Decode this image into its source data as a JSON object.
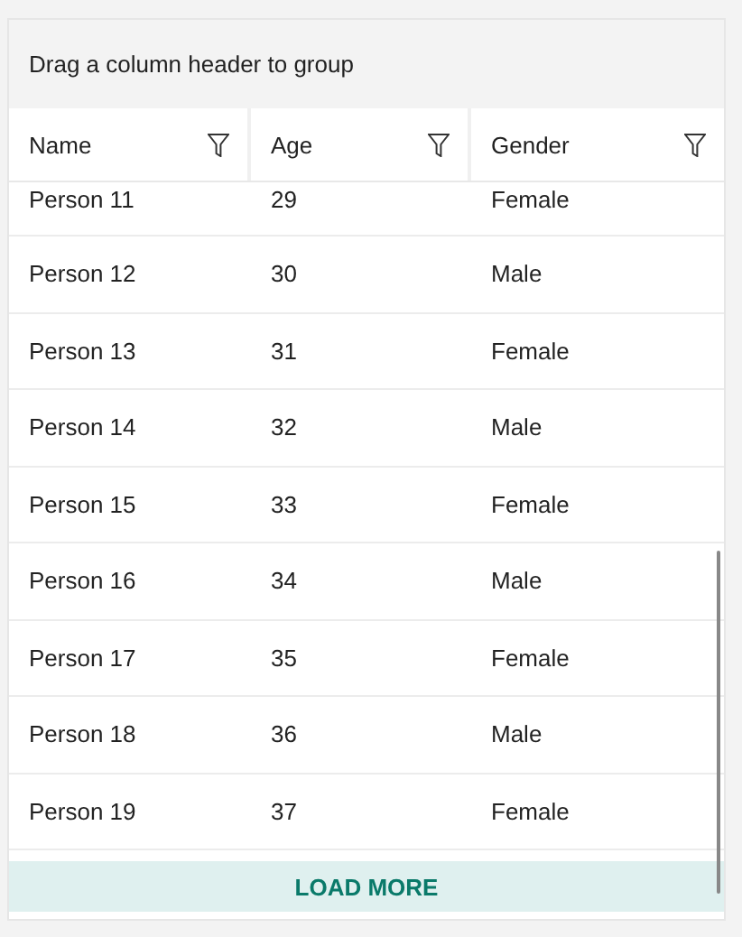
{
  "group_panel": {
    "text": "Drag a column header to group"
  },
  "columns": [
    {
      "label": "Name"
    },
    {
      "label": "Age"
    },
    {
      "label": "Gender"
    }
  ],
  "rows": [
    {
      "cells": [
        "Person 11",
        "29",
        "Female"
      ]
    },
    {
      "cells": [
        "Person 12",
        "30",
        "Male"
      ]
    },
    {
      "cells": [
        "Person 13",
        "31",
        "Female"
      ]
    },
    {
      "cells": [
        "Person 14",
        "32",
        "Male"
      ]
    },
    {
      "cells": [
        "Person 15",
        "33",
        "Female"
      ]
    },
    {
      "cells": [
        "Person 16",
        "34",
        "Male"
      ]
    },
    {
      "cells": [
        "Person 17",
        "35",
        "Female"
      ]
    },
    {
      "cells": [
        "Person 18",
        "36",
        "Male"
      ]
    },
    {
      "cells": [
        "Person 19",
        "37",
        "Female"
      ]
    }
  ],
  "load_more": {
    "label": "LOAD MORE"
  }
}
